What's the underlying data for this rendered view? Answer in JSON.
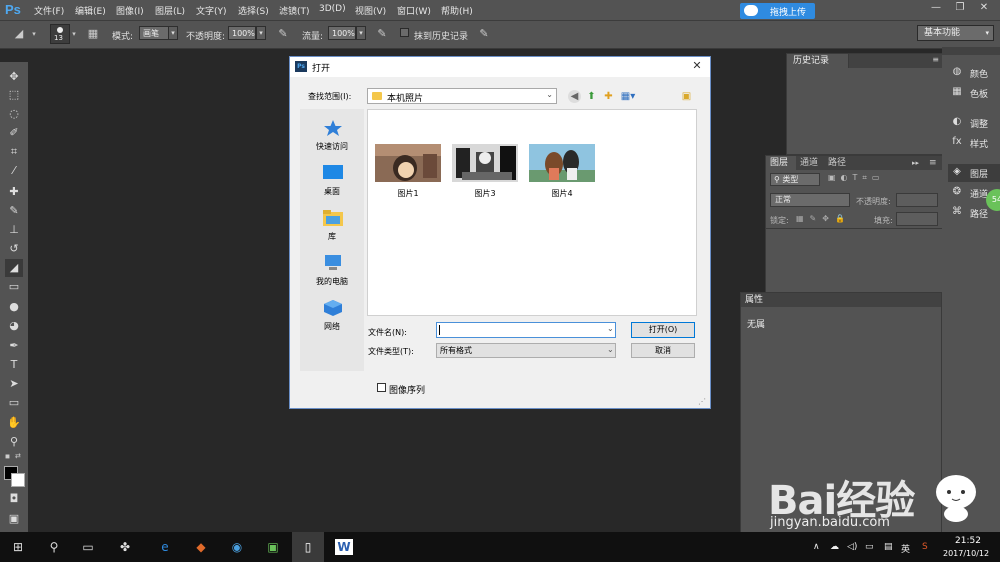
{
  "app": {
    "logo": "Ps",
    "menu": [
      "文件(F)",
      "编辑(E)",
      "图像(I)",
      "图层(L)",
      "文字(Y)",
      "选择(S)",
      "滤镜(T)",
      "3D(D)",
      "视图(V)",
      "窗口(W)",
      "帮助(H)"
    ],
    "upload_label": "拖拽上传",
    "workspace": "基本功能"
  },
  "options": {
    "brush_size": "13",
    "mode_label": "模式:",
    "mode_value": "画笔",
    "opacity_label": "不透明度:",
    "opacity_value": "100%",
    "flow_label": "流量:",
    "flow_value": "100%",
    "history_label": "抹到历史记录"
  },
  "panels": {
    "history_tab": "历史记录",
    "dock": [
      "颜色",
      "色板",
      "调整",
      "样式",
      "图层",
      "通道",
      "路径"
    ],
    "layer_tabs": [
      "图层",
      "通道",
      "路径"
    ],
    "layer_filter": "类型",
    "blend_mode": "正常",
    "layer_opacity_label": "不透明度:",
    "lock_label": "锁定:",
    "fill_label": "填充:",
    "properties_tab": "属性",
    "properties_value": "无属",
    "badge": "54"
  },
  "dialog": {
    "title": "打开",
    "look_in_label": "查找范围(I):",
    "look_in_value": "本机照片",
    "places": [
      "快速访问",
      "桌面",
      "库",
      "我的电脑",
      "网络"
    ],
    "files": [
      "图片1",
      "图片3",
      "图片4"
    ],
    "filename_label": "文件名(N):",
    "filename_value": "",
    "filetype_label": "文件类型(T):",
    "filetype_value": "所有格式",
    "open_button": "打开(O)",
    "cancel_button": "取消",
    "sequence_label": "图像序列",
    "sequence_checked": false
  },
  "taskbar": {
    "ime": "英",
    "time": "21:52",
    "date": "2017/10/12"
  },
  "watermark": {
    "brand": "Bai经验",
    "url": "jingyan.baidu.com"
  }
}
